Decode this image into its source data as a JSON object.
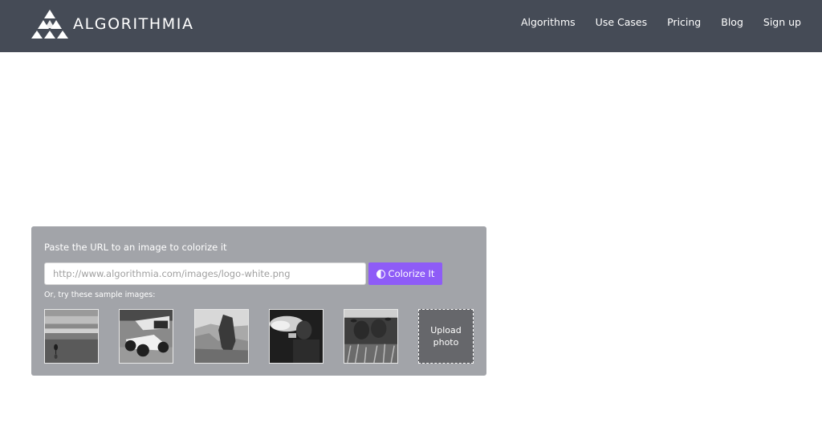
{
  "header": {
    "brand": "ALGORITHMIA",
    "logo_icon": "triangle-mountain-logo",
    "nav": [
      {
        "label": "Algorithms"
      },
      {
        "label": "Use Cases"
      },
      {
        "label": "Pricing"
      },
      {
        "label": "Blog"
      },
      {
        "label": "Sign up"
      }
    ],
    "background_color": "#454b56"
  },
  "colorizer": {
    "prompt": "Paste the URL to an image to colorize it",
    "url_input": {
      "value": "",
      "placeholder": "http://www.algorithmia.com/images/logo-white.png"
    },
    "button": {
      "label": "Colorize It",
      "icon": "half-circle-contrast-icon",
      "color": "#8e5cf7"
    },
    "samples_label": "Or, try these sample images:",
    "samples": [
      {
        "name": "bird-on-beach",
        "description": "grayscale bird standing on wet beach"
      },
      {
        "name": "race-car",
        "description": "grayscale sprint race car"
      },
      {
        "name": "half-dome",
        "description": "grayscale mountain rock formation"
      },
      {
        "name": "fire-breather",
        "description": "grayscale person breathing fire"
      },
      {
        "name": "cows",
        "description": "grayscale cows in grass"
      }
    ],
    "upload": {
      "label_line1": "Upload",
      "label_line2": "photo"
    },
    "panel_color": "#a2a4a9"
  }
}
